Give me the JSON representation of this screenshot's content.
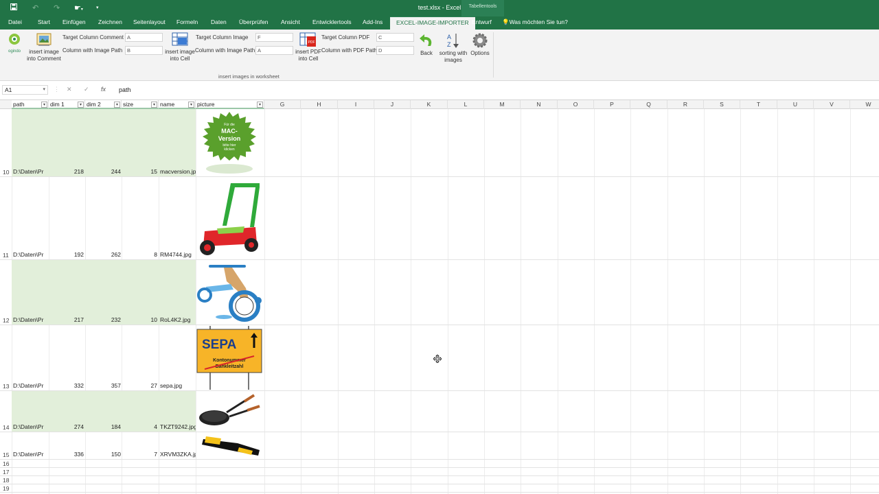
{
  "window": {
    "title": "test.xlsx  -  Excel",
    "context_label": "Tabellentools"
  },
  "tabs": [
    "Datei",
    "Start",
    "Einfügen",
    "Zeichnen",
    "Seitenlayout",
    "Formeln",
    "Daten",
    "Überprüfen",
    "Ansicht",
    "Entwicklertools",
    "Add-Ins",
    "EXCEL-IMAGE-IMPORTER",
    "Entwurf"
  ],
  "tell_me": "Was möchten Sie tun?",
  "ribbon": {
    "brand": "ogindo",
    "btn_comment": [
      "insert image",
      "into Comment"
    ],
    "btn_cell": [
      "insert image",
      "into Cell"
    ],
    "btn_pdf": [
      "insert PDF",
      "into Cell"
    ],
    "btn_back": "Back",
    "btn_sort": [
      "sorting with",
      "images"
    ],
    "btn_options": "Options",
    "labels": {
      "target_comment": "Target Column Comment",
      "image_path_1": "Column with Image Path",
      "target_image": "Target Column Image",
      "image_path_2": "Column with Image Path",
      "target_pdf": "Target Column PDF",
      "pdf_path": "Column with PDF Path"
    },
    "values": {
      "target_comment": "A",
      "image_path_1": "B",
      "target_image": "F",
      "image_path_2": "A",
      "target_pdf": "C",
      "pdf_path": "D"
    },
    "group": "insert images in worksheet"
  },
  "formula_bar": {
    "cell": "A1",
    "formula": "path"
  },
  "columns": [
    "G",
    "H",
    "I",
    "J",
    "K",
    "L",
    "M",
    "N",
    "O",
    "P",
    "Q",
    "R",
    "S",
    "T",
    "U",
    "V",
    "W"
  ],
  "table_headers": [
    "path",
    "dim 1",
    "dim 2",
    "size",
    "name",
    "picture"
  ],
  "rows": [
    {
      "num": "10",
      "path": "D:\\Daten\\Pr",
      "dim1": "218",
      "dim2": "244",
      "size": "15",
      "name": "macversion.jp"
    },
    {
      "num": "11",
      "path": "D:\\Daten\\Pr",
      "dim1": "192",
      "dim2": "262",
      "size": "8",
      "name": "RM4744.jpg"
    },
    {
      "num": "12",
      "path": "D:\\Daten\\Pr",
      "dim1": "217",
      "dim2": "232",
      "size": "10",
      "name": "RoL4K2.jpg"
    },
    {
      "num": "13",
      "path": "D:\\Daten\\Pr",
      "dim1": "332",
      "dim2": "357",
      "size": "27",
      "name": "sepa.jpg"
    },
    {
      "num": "14",
      "path": "D:\\Daten\\Pr",
      "dim1": "274",
      "dim2": "184",
      "size": "4",
      "name": "TKZT9242.jpg"
    },
    {
      "num": "15",
      "path": "D:\\Daten\\Pr",
      "dim1": "336",
      "dim2": "150",
      "size": "7",
      "name": "XRVM3ZKA.jp"
    },
    {
      "num": "16"
    },
    {
      "num": "17"
    },
    {
      "num": "18"
    },
    {
      "num": "19"
    }
  ],
  "images": {
    "mac": [
      "Für die",
      "MAC-",
      "Version",
      "bitte hier",
      "klicken"
    ],
    "sepa": [
      "SEPA",
      "Kontonummer",
      "Bankleitzahl"
    ]
  }
}
